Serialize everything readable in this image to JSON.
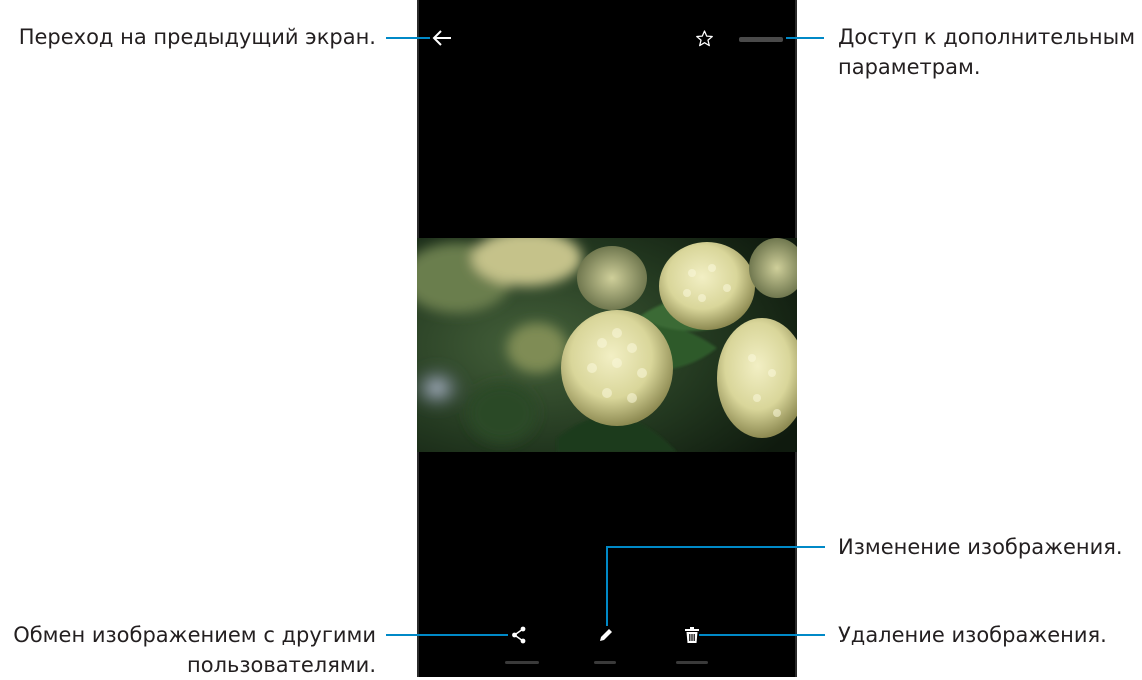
{
  "callouts": {
    "back": "Переход на предыдущий экран.",
    "more_line1": "Доступ к дополнительным",
    "more_line2": "параметрам.",
    "edit": "Изменение изображения.",
    "share_line1": "Обмен изображением с другими",
    "share_line2": "пользователями.",
    "delete": "Удаление изображения."
  },
  "toolbar": {
    "back_icon": "arrow-left-icon",
    "favorite_icon": "star-outline-icon",
    "more_icon": "more-options-icon"
  },
  "bottom_bar": {
    "share_icon": "share-icon",
    "edit_icon": "pencil-icon",
    "delete_icon": "trash-icon"
  },
  "colors": {
    "callout_line": "#0089c7",
    "screen_bg": "#000000"
  }
}
